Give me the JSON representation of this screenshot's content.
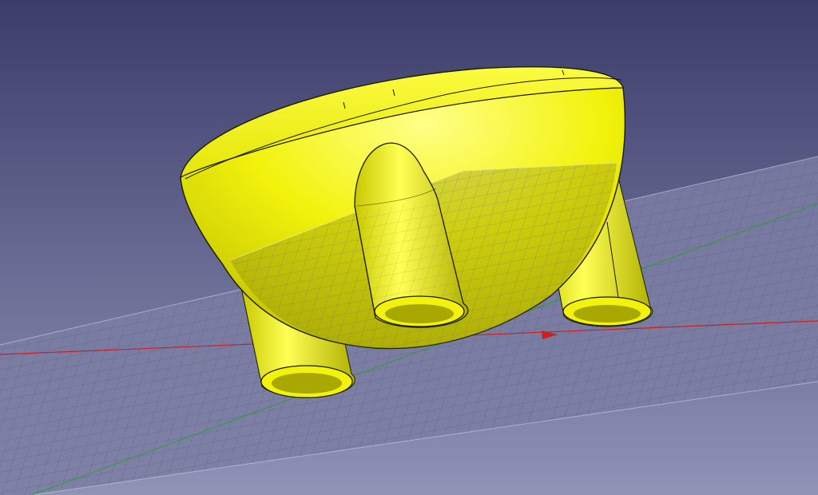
{
  "viewport": {
    "background_top_color": "#3b3c6a",
    "background_bottom_color": "#8f93b6"
  },
  "grid_plane": {
    "fill_color": "#7b7ea3",
    "line_color": "#5c5f82",
    "visible": true
  },
  "axes": {
    "x_axis_color": "#cc2020",
    "y_axis_color": "#2aa02a"
  },
  "model": {
    "body_color": "#f2f20c",
    "shadow_color": "#a8a800",
    "highlight_color": "#ffff88",
    "edge_color": "#1a1a00",
    "parts": [
      "hemisphere-bowl",
      "pointed-leg",
      "cylinder-leg-left",
      "cylinder-leg-right"
    ]
  }
}
